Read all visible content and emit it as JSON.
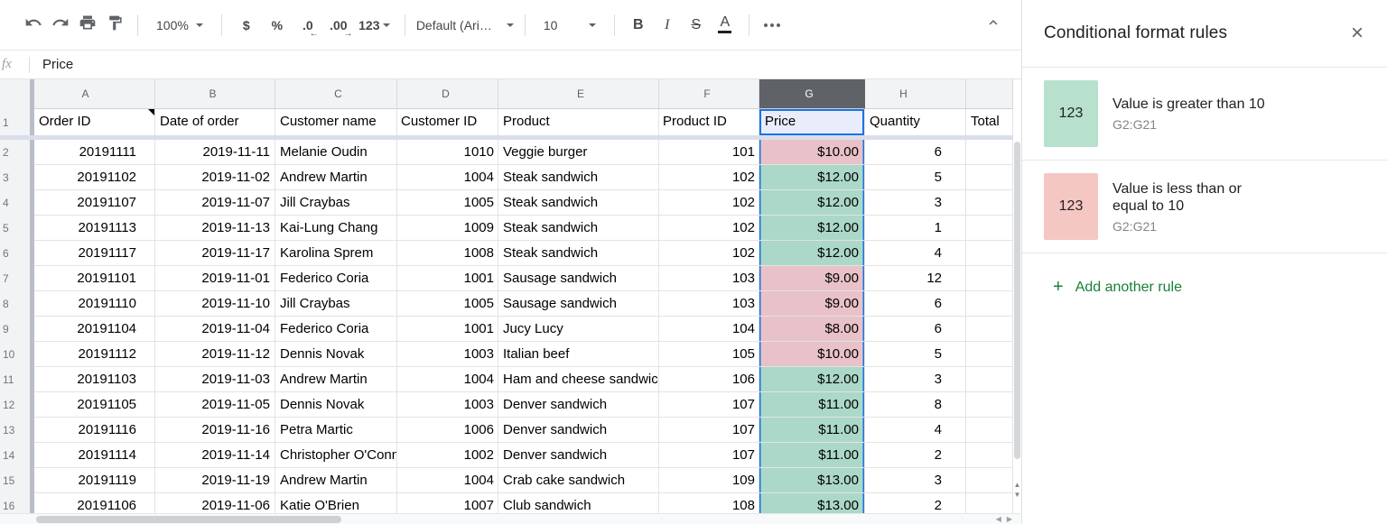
{
  "toolbar": {
    "zoom_value": "100%",
    "currency": "$",
    "percent": "%",
    "decrease_decimal": ".0",
    "decrease_arrow": "←",
    "increase_decimal": ".00",
    "increase_arrow": "→",
    "more_formats": "123",
    "font_name": "Default (Ari…",
    "font_size": "10",
    "bold": "B",
    "italic": "I",
    "strikethrough": "S",
    "text_color": "A"
  },
  "formula_bar": {
    "fx_label": "fx",
    "value": "Price"
  },
  "grid": {
    "column_letters": [
      "A",
      "B",
      "C",
      "D",
      "E",
      "F",
      "G",
      "H",
      ""
    ],
    "selected_column": "G",
    "frozen_row": {
      "num": "1",
      "cells": [
        "Order ID",
        "Date of order",
        "Customer name",
        "Customer ID",
        "Product",
        "Product ID",
        "Price",
        "Quantity",
        "Total"
      ]
    },
    "rows": [
      {
        "num": "2",
        "order_id": "20191111",
        "date": "2019-11-11",
        "customer": "Melanie Oudin",
        "customer_id": "1010",
        "product": "Veggie burger",
        "product_id": "101",
        "price": "$10.00",
        "price_state": "lte",
        "qty": "6"
      },
      {
        "num": "3",
        "order_id": "20191102",
        "date": "2019-11-02",
        "customer": "Andrew Martin",
        "customer_id": "1004",
        "product": "Steak sandwich",
        "product_id": "102",
        "price": "$12.00",
        "price_state": "gt",
        "qty": "5"
      },
      {
        "num": "4",
        "order_id": "20191107",
        "date": "2019-11-07",
        "customer": "Jill Craybas",
        "customer_id": "1005",
        "product": "Steak sandwich",
        "product_id": "102",
        "price": "$12.00",
        "price_state": "gt",
        "qty": "3"
      },
      {
        "num": "5",
        "order_id": "20191113",
        "date": "2019-11-13",
        "customer": "Kai-Lung Chang",
        "customer_id": "1009",
        "product": "Steak sandwich",
        "product_id": "102",
        "price": "$12.00",
        "price_state": "gt",
        "qty": "1"
      },
      {
        "num": "6",
        "order_id": "20191117",
        "date": "2019-11-17",
        "customer": "Karolina Sprem",
        "customer_id": "1008",
        "product": "Steak sandwich",
        "product_id": "102",
        "price": "$12.00",
        "price_state": "gt",
        "qty": "4"
      },
      {
        "num": "7",
        "order_id": "20191101",
        "date": "2019-11-01",
        "customer": "Federico Coria",
        "customer_id": "1001",
        "product": "Sausage sandwich",
        "product_id": "103",
        "price": "$9.00",
        "price_state": "lte",
        "qty": "12"
      },
      {
        "num": "8",
        "order_id": "20191110",
        "date": "2019-11-10",
        "customer": "Jill Craybas",
        "customer_id": "1005",
        "product": "Sausage sandwich",
        "product_id": "103",
        "price": "$9.00",
        "price_state": "lte",
        "qty": "6"
      },
      {
        "num": "9",
        "order_id": "20191104",
        "date": "2019-11-04",
        "customer": "Federico Coria",
        "customer_id": "1001",
        "product": "Jucy Lucy",
        "product_id": "104",
        "price": "$8.00",
        "price_state": "lte",
        "qty": "6"
      },
      {
        "num": "10",
        "order_id": "20191112",
        "date": "2019-11-12",
        "customer": "Dennis Novak",
        "customer_id": "1003",
        "product": "Italian beef",
        "product_id": "105",
        "price": "$10.00",
        "price_state": "lte",
        "qty": "5"
      },
      {
        "num": "11",
        "order_id": "20191103",
        "date": "2019-11-03",
        "customer": "Andrew Martin",
        "customer_id": "1004",
        "product": "Ham and cheese sandwich",
        "product_id": "106",
        "price": "$12.00",
        "price_state": "gt",
        "qty": "3"
      },
      {
        "num": "12",
        "order_id": "20191105",
        "date": "2019-11-05",
        "customer": "Dennis Novak",
        "customer_id": "1003",
        "product": "Denver sandwich",
        "product_id": "107",
        "price": "$11.00",
        "price_state": "gt",
        "qty": "8"
      },
      {
        "num": "13",
        "order_id": "20191116",
        "date": "2019-11-16",
        "customer": "Petra Martic",
        "customer_id": "1006",
        "product": "Denver sandwich",
        "product_id": "107",
        "price": "$11.00",
        "price_state": "gt",
        "qty": "4"
      },
      {
        "num": "14",
        "order_id": "20191114",
        "date": "2019-11-14",
        "customer": "Christopher O'Connell",
        "customer_id": "1002",
        "product": "Denver sandwich",
        "product_id": "107",
        "price": "$11.00",
        "price_state": "gt",
        "qty": "2"
      },
      {
        "num": "15",
        "order_id": "20191119",
        "date": "2019-11-19",
        "customer": "Andrew Martin",
        "customer_id": "1004",
        "product": "Crab cake sandwich",
        "product_id": "109",
        "price": "$13.00",
        "price_state": "gt",
        "qty": "3"
      },
      {
        "num": "16",
        "order_id": "20191106",
        "date": "2019-11-06",
        "customer": "Katie O'Brien",
        "customer_id": "1007",
        "product": "Club sandwich",
        "product_id": "108",
        "price": "$13.00",
        "price_state": "gt",
        "qty": "2"
      }
    ]
  },
  "panel": {
    "title": "Conditional format rules",
    "close_glyph": "×",
    "rules": [
      {
        "swatch_label": "123",
        "swatch_color": "#b7e1cd",
        "condition_line1": "Value is greater than 10",
        "condition_line2": "",
        "range": "G2:G21"
      },
      {
        "swatch_label": "123",
        "swatch_color": "#f4c7c3",
        "condition_line1": "Value is less than or",
        "condition_line2": "equal to 10",
        "range": "G2:G21"
      }
    ],
    "plus_glyph": "+",
    "add_rule_label": "Add another rule"
  },
  "colors": {
    "accent_blue": "#1a73e8",
    "rule_green_cell": "#abd8c8",
    "rule_red_cell": "#e8c2c8",
    "selected_header": "#5f6368",
    "add_rule_green": "#188038"
  }
}
